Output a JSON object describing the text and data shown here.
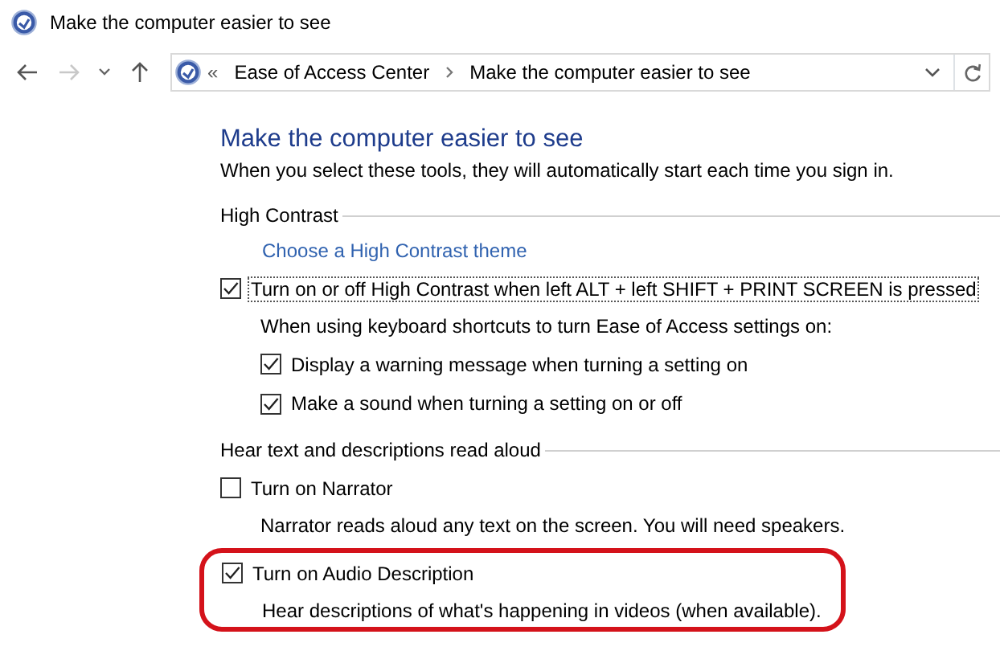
{
  "window": {
    "title": "Make the computer easier to see"
  },
  "toolbar": {
    "back_disabled": false,
    "forward_disabled": true,
    "overflow": "«",
    "breadcrumbs": [
      "Ease of Access Center",
      "Make the computer easier to see"
    ]
  },
  "heading": "Make the computer easier to see",
  "intro": "When you select these tools, they will automatically start each time you sign in.",
  "sections": [
    {
      "title": "High Contrast",
      "items": [
        {
          "kind": "link",
          "text": "Choose a High Contrast theme"
        },
        {
          "kind": "checkbox",
          "label": "Turn on or off High Contrast when left ALT + left SHIFT + PRINT SCREEN is pressed",
          "checked": true,
          "focused": true,
          "highlighted": false,
          "children": [
            {
              "kind": "text",
              "text": "When using keyboard shortcuts to turn Ease of Access settings on:"
            },
            {
              "kind": "checkbox",
              "label": "Display a warning message when turning a setting on",
              "checked": true,
              "focused": false,
              "highlighted": false
            },
            {
              "kind": "checkbox",
              "label": "Make a sound when turning a setting on or off",
              "checked": true,
              "focused": false,
              "highlighted": false
            }
          ]
        }
      ]
    },
    {
      "title": "Hear text and descriptions read aloud",
      "items": [
        {
          "kind": "checkbox",
          "label": "Turn on Narrator",
          "checked": false,
          "focused": false,
          "highlighted": false,
          "children": [
            {
              "kind": "text",
              "text": "Narrator reads aloud any text on the screen. You will need speakers."
            }
          ]
        },
        {
          "kind": "checkbox",
          "label": "Turn on Audio Description",
          "checked": true,
          "focused": false,
          "highlighted": true,
          "children": [
            {
              "kind": "text",
              "text": "Hear descriptions of what's happening in videos (when available)."
            }
          ]
        }
      ]
    }
  ]
}
